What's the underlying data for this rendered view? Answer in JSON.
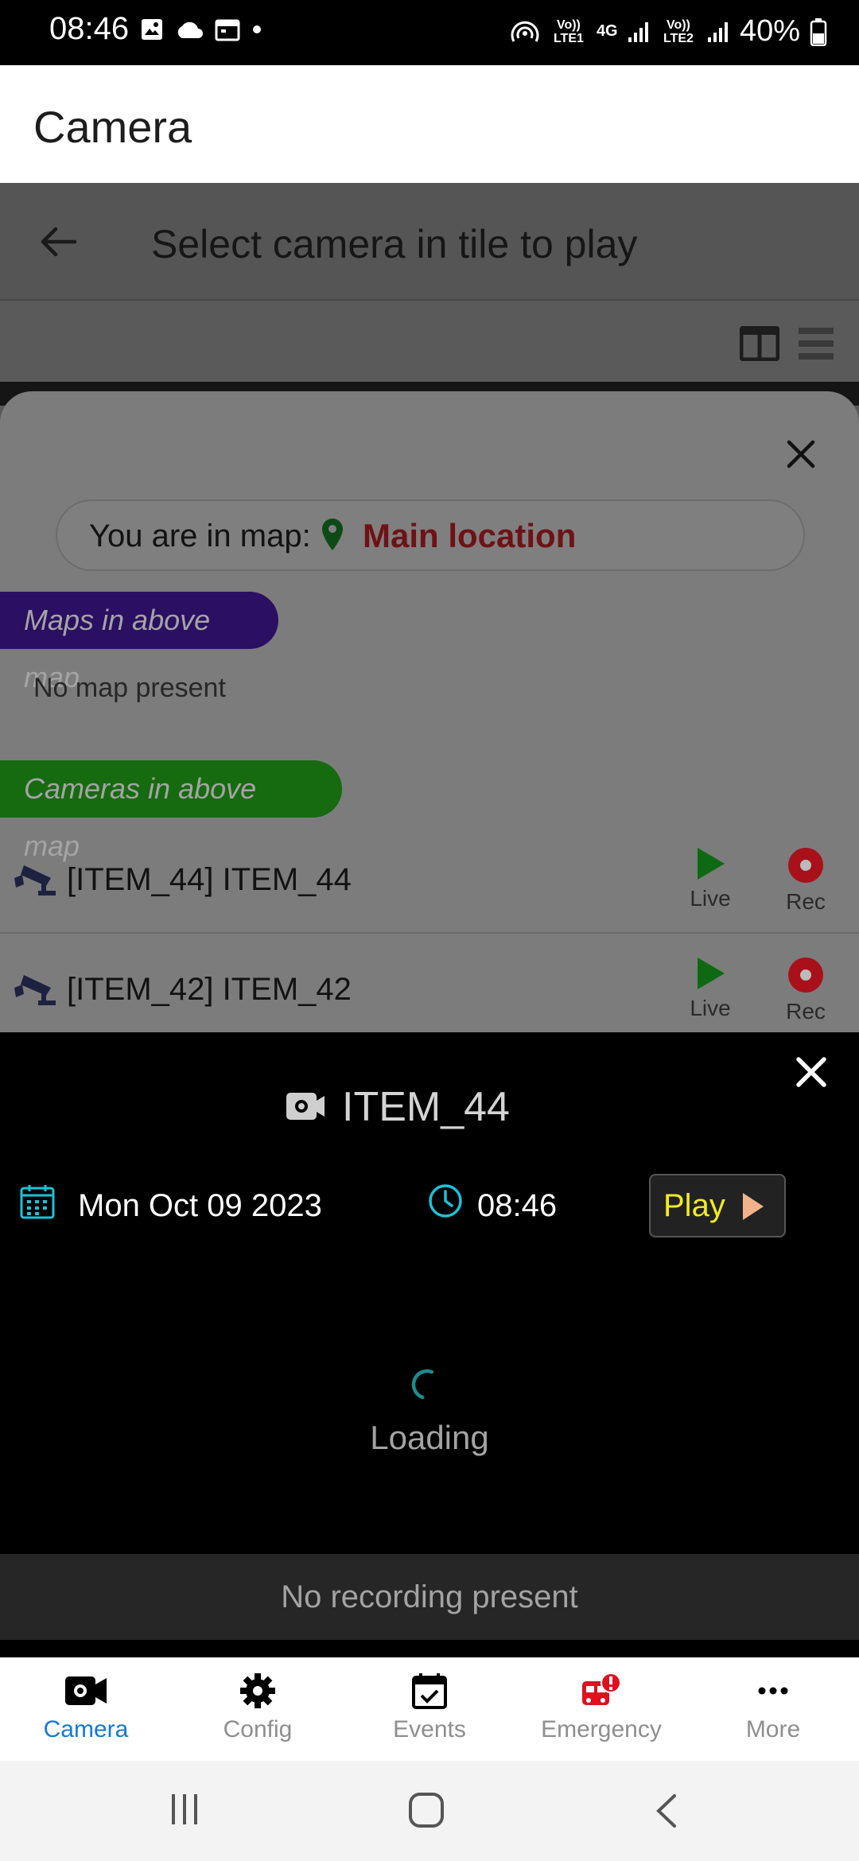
{
  "status_bar": {
    "time": "08:46",
    "lte1": "Vo)) LTE1",
    "net": "4G",
    "lte2": "Vo)) LTE2",
    "battery": "40%"
  },
  "app_bar": {
    "title": "Camera"
  },
  "underlying": {
    "title": "Select camera in tile to play"
  },
  "sheet": {
    "location_label": "You are in map:",
    "location_name": "Main location",
    "maps_tag": "Maps in above map",
    "no_map": "No map present",
    "cameras_tag": "Cameras in above map",
    "cameras": [
      {
        "label": "[ITEM_44] ITEM_44",
        "live": "Live",
        "rec": "Rec"
      },
      {
        "label": "[ITEM_42] ITEM_42",
        "live": "Live",
        "rec": "Rec"
      }
    ]
  },
  "player": {
    "camera_name": "ITEM_44",
    "date": "Mon Oct 09 2023",
    "time": "08:46",
    "play_label": "Play",
    "loading": "Loading",
    "no_recording": "No recording present"
  },
  "bottom_nav": [
    {
      "label": "Camera",
      "icon": "camera-icon",
      "active": true
    },
    {
      "label": "Config",
      "icon": "gear-icon"
    },
    {
      "label": "Events",
      "icon": "calendar-check-icon"
    },
    {
      "label": "Emergency",
      "icon": "emergency-icon"
    },
    {
      "label": "More",
      "icon": "more-icon"
    }
  ],
  "colors": {
    "accent": "#1677d4",
    "location": "#6e1216",
    "maps_tag": "#2b0f62",
    "cams_tag": "#166a0f",
    "play_text": "#f0ec20",
    "cyan": "#19c3d8",
    "live_green": "#0e6a12",
    "rec_red": "#a8101a"
  }
}
